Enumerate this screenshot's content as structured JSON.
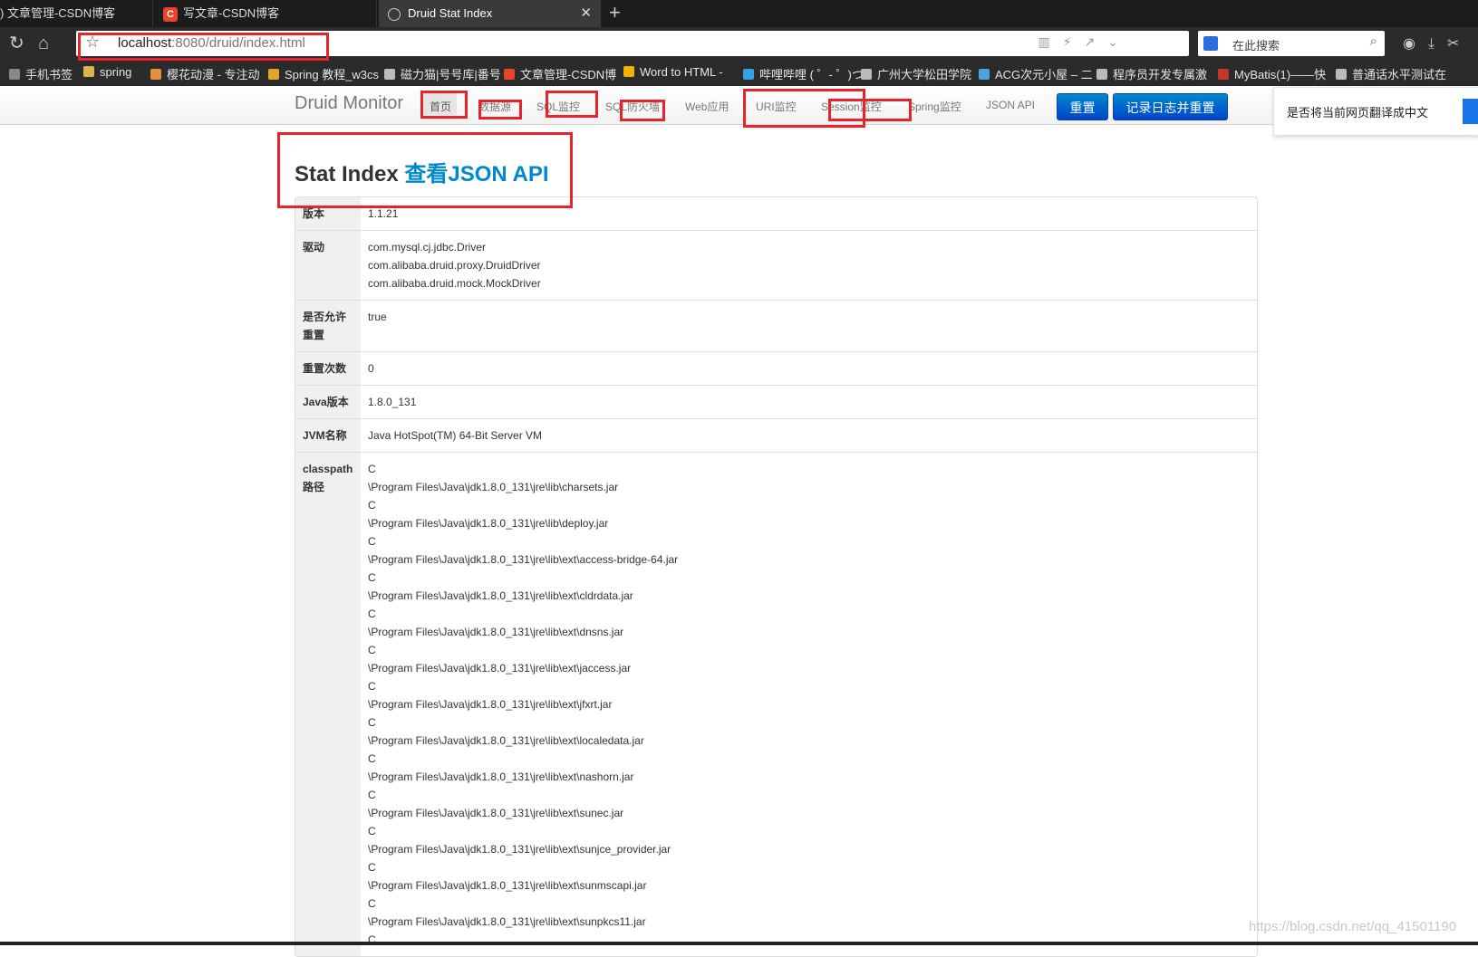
{
  "browser": {
    "tabs": [
      {
        "label": ") 文章管理-CSDN博客"
      },
      {
        "label": "写文章-CSDN博客"
      },
      {
        "label": "Druid Stat Index"
      }
    ],
    "url_host": "localhost",
    "url_path": ":8080/druid/index.html",
    "search_placeholder": "在此搜索",
    "bookmarks": [
      "手机书签",
      "spring",
      "樱花动漫 - 专注动",
      "Spring 教程_w3cs",
      "磁力猫|号号库|番号",
      "文章管理-CSDN博",
      "Word to HTML -",
      "哔哩哔哩 ( ゜- ゜)つ",
      "广州大学松田学院",
      "ACG次元小屋 – 二",
      "程序员开发专属激",
      "MyBatis(1)——快",
      "普通话水平测试在"
    ]
  },
  "druid_nav": {
    "brand": "Druid Monitor",
    "items": [
      "首页",
      "数据源",
      "SQL监控",
      "SQL防火墙",
      "Web应用",
      "URI监控",
      "Session监控",
      "Spring监控",
      "JSON API"
    ],
    "reset_button": "重置",
    "log_reset_button": "记录日志并重置"
  },
  "translate_prompt": "是否将当前网页翻译成中文",
  "page": {
    "title": "Stat Index",
    "json_link": "查看JSON API"
  },
  "stats": [
    {
      "label": "版本",
      "values": [
        "1.1.21"
      ]
    },
    {
      "label": "驱动",
      "values": [
        "com.mysql.cj.jdbc.Driver",
        "com.alibaba.druid.proxy.DruidDriver",
        "com.alibaba.druid.mock.MockDriver"
      ]
    },
    {
      "label": "是否允许重置",
      "values": [
        "true"
      ]
    },
    {
      "label": "重置次数",
      "values": [
        "0"
      ]
    },
    {
      "label": "Java版本",
      "values": [
        "1.8.0_131"
      ]
    },
    {
      "label": "JVM名称",
      "values": [
        "Java HotSpot(TM) 64-Bit Server VM"
      ]
    },
    {
      "label": "classpath路径",
      "values": [
        "C",
        "\\Program Files\\Java\\jdk1.8.0_131\\jre\\lib\\charsets.jar",
        "C",
        "\\Program Files\\Java\\jdk1.8.0_131\\jre\\lib\\deploy.jar",
        "C",
        "\\Program Files\\Java\\jdk1.8.0_131\\jre\\lib\\ext\\access-bridge-64.jar",
        "C",
        "\\Program Files\\Java\\jdk1.8.0_131\\jre\\lib\\ext\\cldrdata.jar",
        "C",
        "\\Program Files\\Java\\jdk1.8.0_131\\jre\\lib\\ext\\dnsns.jar",
        "C",
        "\\Program Files\\Java\\jdk1.8.0_131\\jre\\lib\\ext\\jaccess.jar",
        "C",
        "\\Program Files\\Java\\jdk1.8.0_131\\jre\\lib\\ext\\jfxrt.jar",
        "C",
        "\\Program Files\\Java\\jdk1.8.0_131\\jre\\lib\\ext\\localedata.jar",
        "C",
        "\\Program Files\\Java\\jdk1.8.0_131\\jre\\lib\\ext\\nashorn.jar",
        "C",
        "\\Program Files\\Java\\jdk1.8.0_131\\jre\\lib\\ext\\sunec.jar",
        "C",
        "\\Program Files\\Java\\jdk1.8.0_131\\jre\\lib\\ext\\sunjce_provider.jar",
        "C",
        "\\Program Files\\Java\\jdk1.8.0_131\\jre\\lib\\ext\\sunmscapi.jar",
        "C",
        "\\Program Files\\Java\\jdk1.8.0_131\\jre\\lib\\ext\\sunpkcs11.jar",
        "C"
      ]
    }
  ],
  "watermark": "https://blog.csdn.net/qq_41501190",
  "colors": {
    "accent": "#0088cc",
    "annotation": "#e8232b",
    "button": "#0055cc"
  }
}
